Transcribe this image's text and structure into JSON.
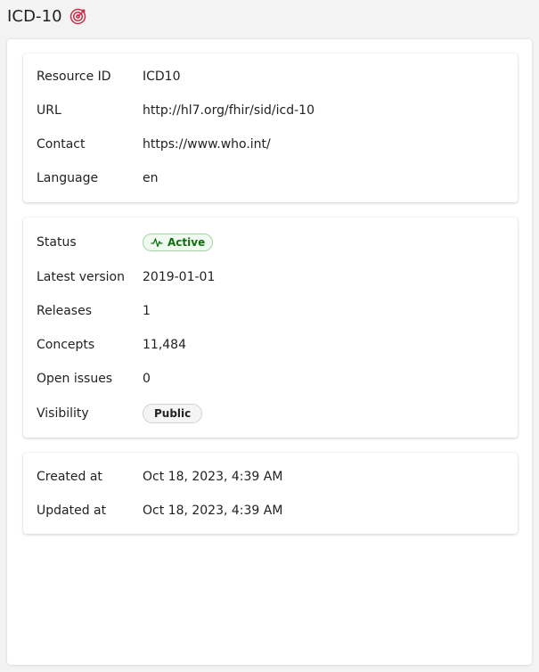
{
  "header": {
    "title": "ICD-10",
    "icon": "target-icon",
    "icon_color": "#c4314b"
  },
  "general": {
    "resource_id": {
      "label": "Resource ID",
      "value": "ICD10"
    },
    "url": {
      "label": "URL",
      "value": "http://hl7.org/fhir/sid/icd-10"
    },
    "contact": {
      "label": "Contact",
      "value": "https://www.who.int/"
    },
    "language": {
      "label": "Language",
      "value": "en"
    }
  },
  "details": {
    "status": {
      "label": "Status",
      "value": "Active",
      "icon": "pulse-icon",
      "color": "#0e700e"
    },
    "latest_version": {
      "label": "Latest version",
      "value": "2019-01-01"
    },
    "releases": {
      "label": "Releases",
      "value": "1"
    },
    "concepts": {
      "label": "Concepts",
      "value": "11,484"
    },
    "open_issues": {
      "label": "Open issues",
      "value": "0"
    },
    "visibility": {
      "label": "Visibility",
      "value": "Public"
    }
  },
  "dates": {
    "created_at": {
      "label": "Created at",
      "value": "Oct 18, 2023, 4:39 AM"
    },
    "updated_at": {
      "label": "Updated at",
      "value": "Oct 18, 2023, 4:39 AM"
    }
  }
}
